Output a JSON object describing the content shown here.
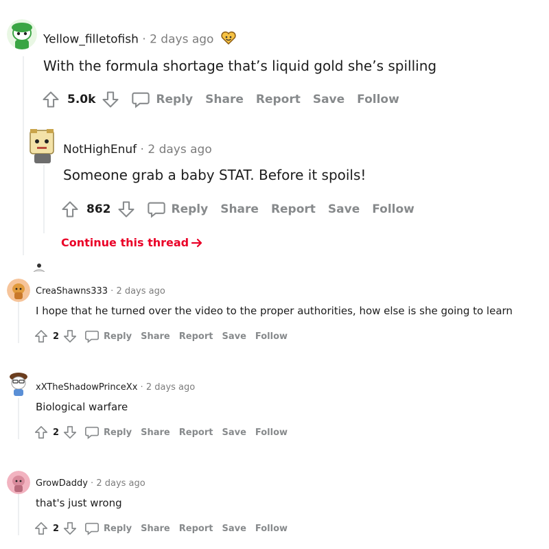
{
  "actions": {
    "reply": "Reply",
    "share": "Share",
    "report": "Report",
    "save": "Save",
    "follow": "Follow"
  },
  "comments": [
    {
      "username": "Yellow_filletofish",
      "separator": "·",
      "timestamp": "2 days ago",
      "body": "With the formula shortage that’s liquid gold she’s spilling",
      "score": "5.0k"
    },
    {
      "username": "NotHighEnuf",
      "separator": "·",
      "timestamp": "2 days ago",
      "body": "Someone grab a baby STAT. Before it spoils!",
      "score": "862"
    },
    {
      "username": "CreaShawns333",
      "separator": "·",
      "timestamp": "2 days ago",
      "body": "I hope that he turned over the video to the proper authorities, how else is she going to learn",
      "score": "2"
    },
    {
      "username": "xXTheShadowPrinceXx",
      "separator": "·",
      "timestamp": "2 days ago",
      "body": "Biological warfare",
      "score": "2"
    },
    {
      "username": "GrowDaddy",
      "separator": "·",
      "timestamp": "2 days ago",
      "body": "that's just wrong",
      "score": "2"
    }
  ],
  "continue_thread": {
    "label": "Continue this thread",
    "icon": "arrow-right-icon"
  },
  "icons": {
    "upvote": "upvote-arrow-icon",
    "downvote": "downvote-arrow-icon",
    "reply": "speech-bubble-icon"
  },
  "colors": {
    "link_red": "#ea0027",
    "action_gray": "#878a8c",
    "meta_gray": "#7c7c7c",
    "text": "#1c1c1c"
  }
}
